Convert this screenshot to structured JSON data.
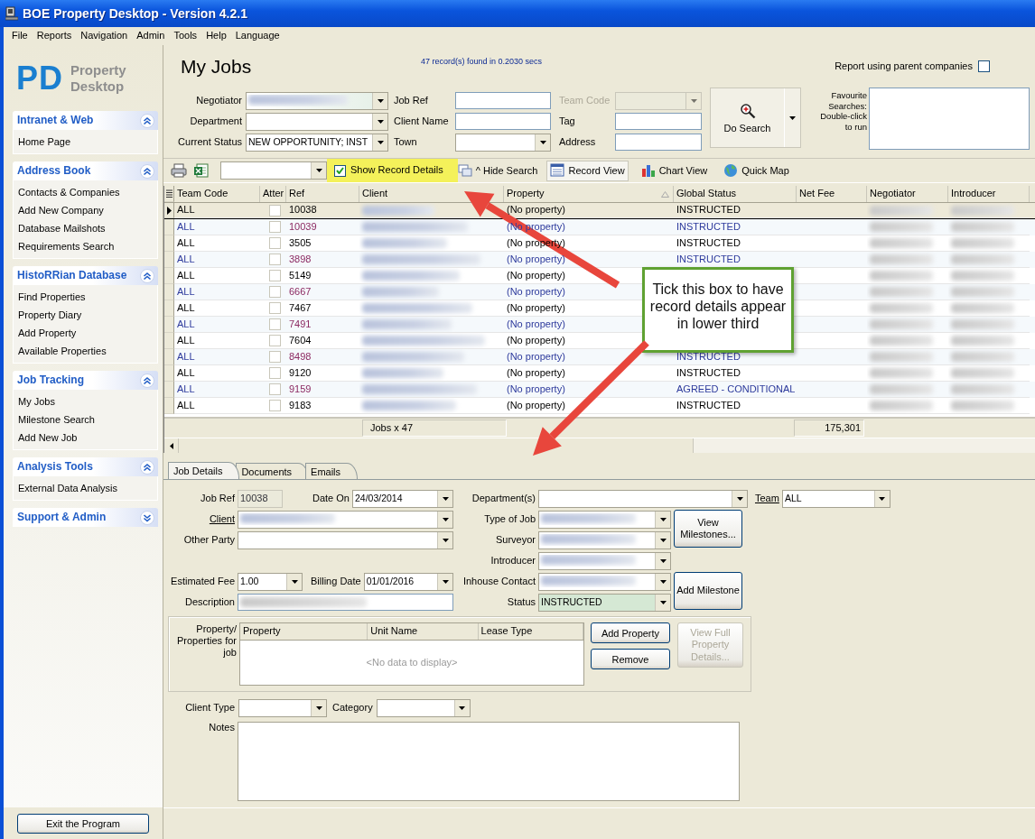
{
  "window": {
    "title": "BOE Property Desktop - Version 4.2.1"
  },
  "menu": [
    "File",
    "Reports",
    "Navigation",
    "Admin",
    "Tools",
    "Help",
    "Language"
  ],
  "sidebar": {
    "logo": {
      "initials": "PD",
      "words": [
        "Property",
        "Desktop"
      ]
    },
    "groups": [
      {
        "title": "Intranet & Web",
        "expanded": true,
        "items": [
          "Home Page"
        ]
      },
      {
        "title": "Address Book",
        "expanded": true,
        "items": [
          "Contacts & Companies",
          "Add New Company",
          "Database Mailshots",
          "Requirements Search"
        ]
      },
      {
        "title": "HistoRRian Database",
        "expanded": true,
        "items": [
          "Find Properties",
          "Property Diary",
          "Add Property",
          "Available Properties"
        ]
      },
      {
        "title": "Job Tracking",
        "expanded": true,
        "items": [
          "My Jobs",
          "Milestone Search",
          "Add New Job"
        ]
      },
      {
        "title": "Analysis Tools",
        "expanded": true,
        "items": [
          "External Data Analysis"
        ]
      },
      {
        "title": "Support & Admin",
        "expanded": false
      }
    ],
    "exit_button": "Exit the Program"
  },
  "header": {
    "title": "My Jobs",
    "record_count": "47 record(s) found in 0.2030 secs",
    "parent_companies": {
      "label": "Report using parent companies",
      "checked": false
    }
  },
  "search": {
    "columns": [
      [
        {
          "label": "Negotiator",
          "kind": "combo",
          "redacted": true
        },
        {
          "label": "Department",
          "kind": "combo"
        },
        {
          "label": "Current Status",
          "kind": "combo",
          "value": "NEW OPPORTUNITY; INST"
        }
      ],
      [
        {
          "label": "Job Ref",
          "kind": "text"
        },
        {
          "label": "Client Name",
          "kind": "text"
        },
        {
          "label": "Town",
          "kind": "combo"
        }
      ],
      [
        {
          "label": "Team Code",
          "kind": "combo",
          "disabled": true
        },
        {
          "label": "Tag",
          "kind": "text"
        },
        {
          "label": "Address",
          "kind": "text"
        }
      ]
    ],
    "search_button": "Do Search",
    "favourites_label": "Favourite Searches: Double-click to run"
  },
  "toolbar": {
    "show_details": {
      "label": "Show Record Details",
      "checked": true,
      "highlighted": true
    },
    "hide_search": "^ Hide Search",
    "views": [
      {
        "label": "Record View",
        "kind": "list",
        "selected": true
      },
      {
        "label": "Chart View",
        "kind": "chart",
        "selected": false
      },
      {
        "label": "Quick Map",
        "kind": "globe",
        "selected": false
      }
    ]
  },
  "grid": {
    "columns": [
      {
        "label": "Team Code",
        "sorted": false
      },
      {
        "label": "Atter",
        "sorted": false
      },
      {
        "label": "Ref",
        "sorted": false
      },
      {
        "label": "Client",
        "sorted": false
      },
      {
        "label": "Property",
        "sorted": true
      },
      {
        "label": "Global Status",
        "sorted": false
      },
      {
        "label": "Net Fee",
        "sorted": false
      },
      {
        "label": "Negotiator",
        "sorted": false
      },
      {
        "label": "Introducer",
        "sorted": false
      }
    ],
    "rows": [
      {
        "team_code": "ALL",
        "checked": false,
        "ref": "10038",
        "property": "(No property)",
        "status": "INSTRUCTED",
        "selected": true
      },
      {
        "team_code": "ALL",
        "checked": false,
        "ref": "10039",
        "property": "(No property)",
        "status": "INSTRUCTED",
        "selected": false
      },
      {
        "team_code": "ALL",
        "checked": false,
        "ref": "3505",
        "property": "(No property)",
        "status": "INSTRUCTED",
        "selected": false
      },
      {
        "team_code": "ALL",
        "checked": false,
        "ref": "3898",
        "property": "(No property)",
        "status": "INSTRUCTED",
        "selected": false
      },
      {
        "team_code": "ALL",
        "checked": false,
        "ref": "5149",
        "property": "(No property)",
        "selected": false
      },
      {
        "team_code": "ALL",
        "checked": false,
        "ref": "6667",
        "property": "(No property)",
        "selected": false
      },
      {
        "team_code": "ALL",
        "checked": false,
        "ref": "7467",
        "property": "(No property)",
        "selected": false
      },
      {
        "team_code": "ALL",
        "checked": false,
        "ref": "7491",
        "property": "(No property)",
        "selected": false
      },
      {
        "team_code": "ALL",
        "checked": false,
        "ref": "7604",
        "property": "(No property)",
        "selected": false
      },
      {
        "team_code": "ALL",
        "checked": false,
        "ref": "8498",
        "property": "(No property)",
        "status": "INSTRUCTED",
        "selected": false
      },
      {
        "team_code": "ALL",
        "checked": false,
        "ref": "9120",
        "property": "(No property)",
        "status": "INSTRUCTED",
        "selected": false
      },
      {
        "team_code": "ALL",
        "checked": false,
        "ref": "9159",
        "property": "(No property)",
        "status": "AGREED - CONDITIONAL",
        "selected": false
      },
      {
        "team_code": "ALL",
        "checked": false,
        "ref": "9183",
        "property": "(No property)",
        "status": "INSTRUCTED",
        "selected": false
      }
    ],
    "footer": {
      "count": "Jobs x 47",
      "net_fee_total": "175,301"
    }
  },
  "annotation": {
    "text": "Tick this box to have record details appear in lower third"
  },
  "details": {
    "tabs": [
      {
        "label": "Job Details",
        "selected": true
      },
      {
        "label": "Documents",
        "selected": false
      },
      {
        "label": "Emails",
        "selected": false
      }
    ],
    "form_rows": [
      {
        "left": [
          {
            "label": "Job Ref",
            "kind": "readonly",
            "value": "10038"
          },
          {
            "label": "Date On",
            "kind": "combo",
            "value": "24/03/2014"
          }
        ],
        "mid": {
          "label": "Department(s)",
          "kind": "combo"
        },
        "extra": {
          "label": "Team",
          "kind": "combo",
          "value": "ALL",
          "link": true
        }
      },
      {
        "left": [
          {
            "label": "Client",
            "kind": "combo",
            "redacted": true,
            "link": true
          }
        ],
        "mid": {
          "label": "Type of Job",
          "kind": "combo",
          "redacted": true
        }
      },
      {
        "left": [
          {
            "label": "Other Party",
            "kind": "combo"
          }
        ],
        "mid": {
          "label": "Surveyor",
          "kind": "combo",
          "redacted": true
        }
      },
      {
        "mid": {
          "label": "Introducer",
          "kind": "combo",
          "redacted": true
        }
      },
      {
        "left": [
          {
            "label": "Estimated Fee",
            "kind": "combo",
            "value": "1.00"
          },
          {
            "label": "Billing Date",
            "kind": "combo",
            "value": "01/01/2016"
          }
        ],
        "mid": {
          "label": "Inhouse Contact",
          "kind": "combo",
          "redacted": true
        }
      },
      {
        "left": [
          {
            "label": "Description",
            "kind": "text",
            "redacted": true
          }
        ],
        "mid": {
          "label": "Status",
          "kind": "combo",
          "value": "INSTRUCTED",
          "highlighted": true
        }
      }
    ],
    "side_buttons": [
      "View Milestones...",
      "Add Milestone"
    ],
    "properties": {
      "label": "Property/ Properties for job",
      "columns": [
        "Property",
        "Unit Name",
        "Lease Type"
      ],
      "empty_text": "<No data to display>",
      "buttons": [
        {
          "label": "Add Property",
          "disabled": false
        },
        {
          "label": "Remove",
          "disabled": false
        },
        {
          "label": "View Full Property Details...",
          "disabled": true
        }
      ]
    },
    "lower_fields": [
      {
        "label": "Client Type",
        "kind": "combo"
      },
      {
        "label": "Category",
        "kind": "combo"
      }
    ],
    "notes_label": "Notes"
  }
}
